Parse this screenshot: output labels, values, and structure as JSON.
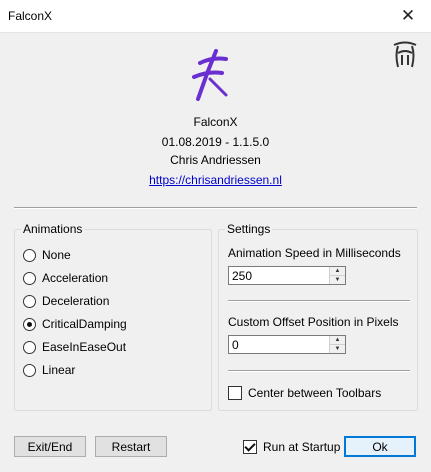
{
  "window": {
    "title": "FalconX",
    "close_glyph": "✕"
  },
  "about": {
    "app_name": "FalconX",
    "version_line": "01.08.2019 - 1.1.5.0",
    "author": "Chris Andriessen",
    "website": "https://chrisandriessen.nl",
    "logo_color": "#6a2fd0"
  },
  "animations": {
    "title": "Animations",
    "options": [
      {
        "label": "None",
        "checked": false
      },
      {
        "label": "Acceleration",
        "checked": false
      },
      {
        "label": "Deceleration",
        "checked": false
      },
      {
        "label": "CriticalDamping",
        "checked": true
      },
      {
        "label": "EaseInEaseOut",
        "checked": false
      },
      {
        "label": "Linear",
        "checked": false
      }
    ]
  },
  "settings": {
    "title": "Settings",
    "speed_label": "Animation Speed in Milliseconds",
    "speed_value": "250",
    "offset_label": "Custom Offset Position in Pixels",
    "offset_value": "0",
    "center_label": "Center between Toolbars",
    "center_checked": false
  },
  "footer": {
    "exit_label": "Exit/End",
    "restart_label": "Restart",
    "startup_label": "Run at Startup",
    "startup_checked": true,
    "ok_label": "Ok"
  }
}
